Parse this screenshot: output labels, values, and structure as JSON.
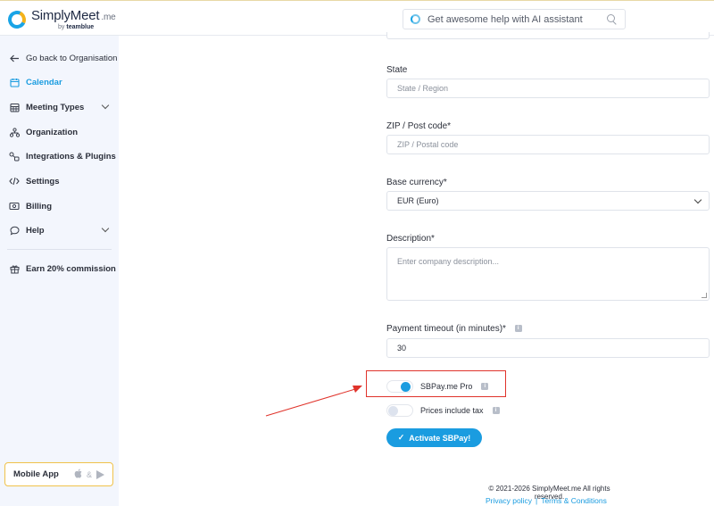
{
  "header": {
    "logo_main": "SimplyMeet",
    "logo_me": ".me",
    "logo_by": "by",
    "logo_brand": "teamblue",
    "ai_search_placeholder": "Get awesome help with AI assistant"
  },
  "sidebar": {
    "items": [
      {
        "label": "Go back to Organisation",
        "icon": "arrow-left-icon"
      },
      {
        "label": "Calendar",
        "icon": "calendar-icon"
      },
      {
        "label": "Meeting Types",
        "icon": "grid-calendar-icon"
      },
      {
        "label": "Organization",
        "icon": "org-chart-icon"
      },
      {
        "label": "Integrations & Plugins",
        "icon": "plugins-icon"
      },
      {
        "label": "Settings",
        "icon": "code-icon"
      },
      {
        "label": "Billing",
        "icon": "billing-icon"
      },
      {
        "label": "Help",
        "icon": "chat-help-icon"
      },
      {
        "label": "Earn 20% commission",
        "icon": "gift-icon"
      }
    ],
    "mobile_app_label": "Mobile App",
    "mobile_app_amp": "&"
  },
  "form": {
    "state_label": "State",
    "state_placeholder": "State / Region",
    "zip_label": "ZIP / Post code*",
    "zip_placeholder": "ZIP / Postal code",
    "currency_label": "Base currency*",
    "currency_value": "EUR (Euro)",
    "description_label": "Description*",
    "description_placeholder": "Enter company description...",
    "timeout_label": "Payment timeout (in minutes)*",
    "timeout_value": "30",
    "toggle_pro_label": "SBPay.me Pro",
    "toggle_tax_label": "Prices include tax",
    "activate_label": "Activate SBPay!",
    "info_glyph": "i"
  },
  "footer": {
    "copyright": "© 2021-2026 SimplyMeet.me All rights reserved.",
    "privacy": "Privacy policy",
    "separator": "|",
    "terms": "Terms & Conditions"
  },
  "colors": {
    "accent": "#1a9ce0",
    "annotation": "#e0332b",
    "mobile_border": "#f0c24a"
  }
}
